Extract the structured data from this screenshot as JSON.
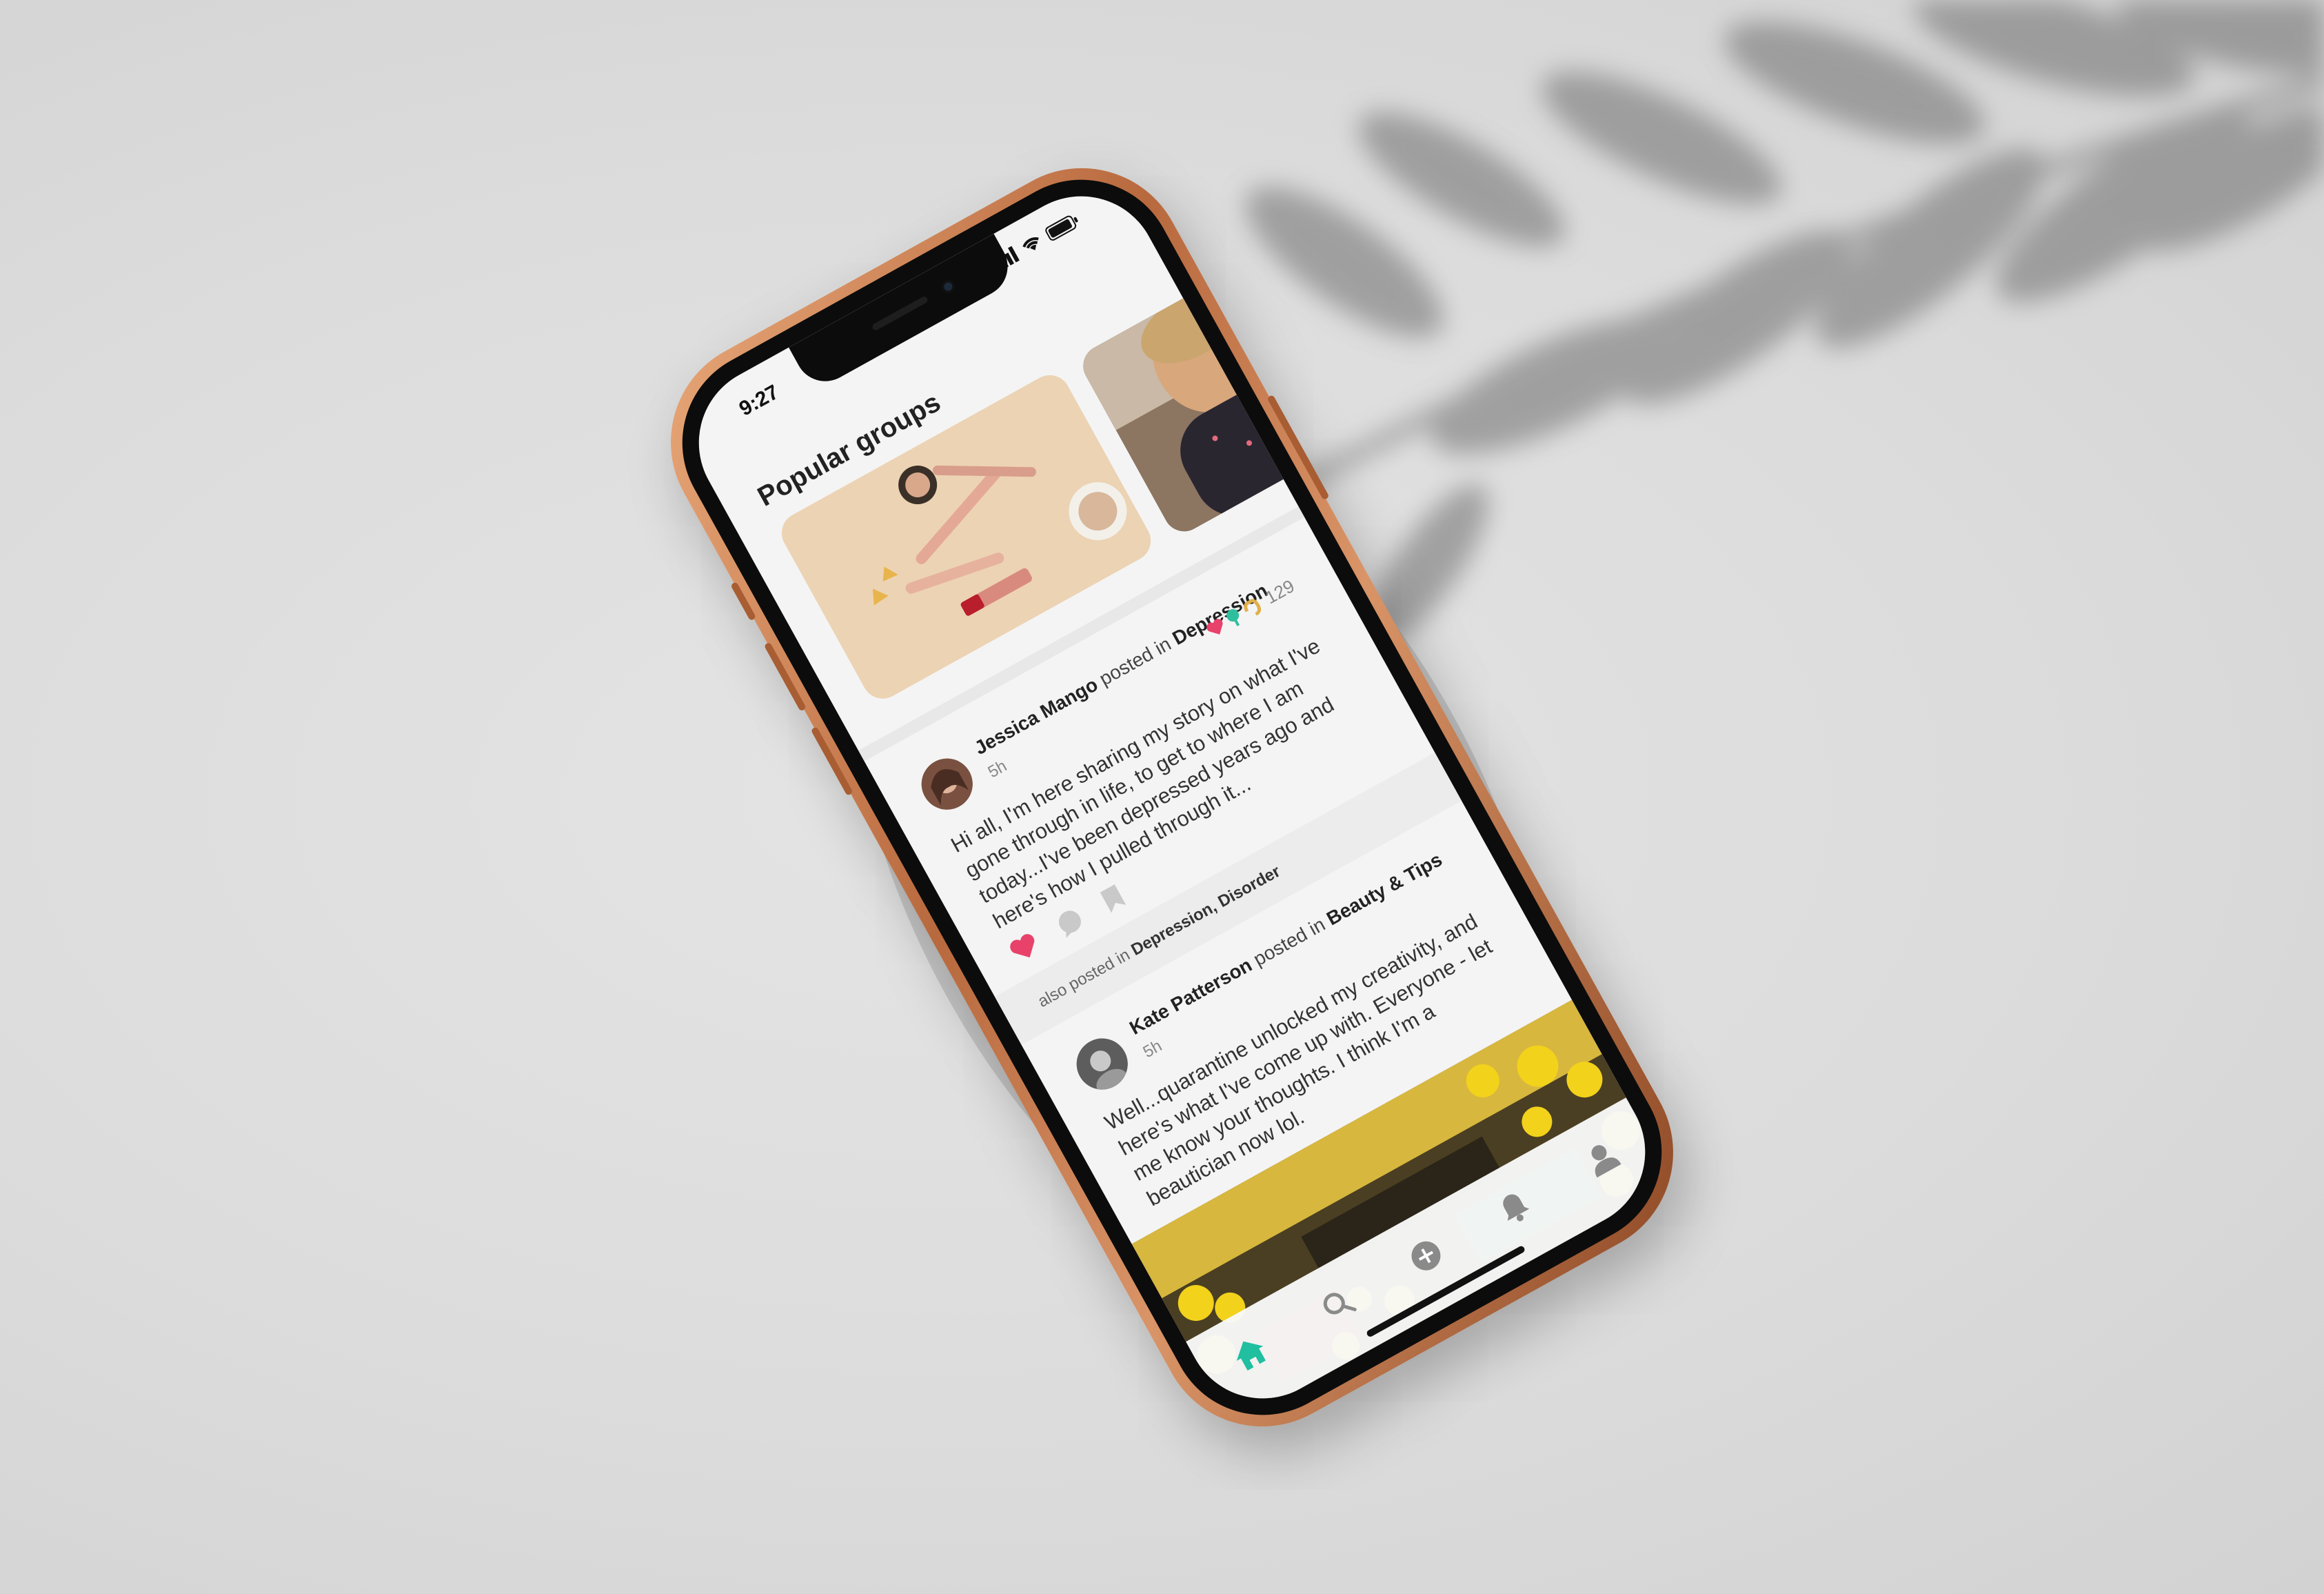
{
  "phone": {
    "status_bar": {
      "time": "9:27"
    },
    "feed": {
      "section_title": "Popular groups",
      "posts": [
        {
          "author": "Jessica Mango",
          "posted_in_label": "posted in",
          "group": "Depression",
          "time_ago": "5h",
          "text": "Hi all, I'm here sharing my story on what I've gone through in life, to get to where I am today...I've been depressed years ago and here's how I pulled through it...",
          "reaction_count": "129",
          "also_posted_label": "also posted in",
          "also_posted_groups": "Depression, Disorder"
        },
        {
          "author": "Kate Patterson",
          "posted_in_label": "posted in",
          "group": "Beauty & Tips",
          "time_ago": "5h",
          "text": "Well...quarantine unlocked my creativity, and here's what I've come up with. Everyone - let me know your thoughts. I think I'm a beautician now lol."
        }
      ]
    },
    "tab_bar": {
      "tabs": [
        "home-icon",
        "search-icon",
        "add-icon",
        "bell-icon",
        "profile-icon"
      ],
      "active": "home-icon"
    },
    "colors": {
      "accent": "#1fbfa0",
      "heart": "#e8426a",
      "frame": "#c07a4c"
    }
  }
}
